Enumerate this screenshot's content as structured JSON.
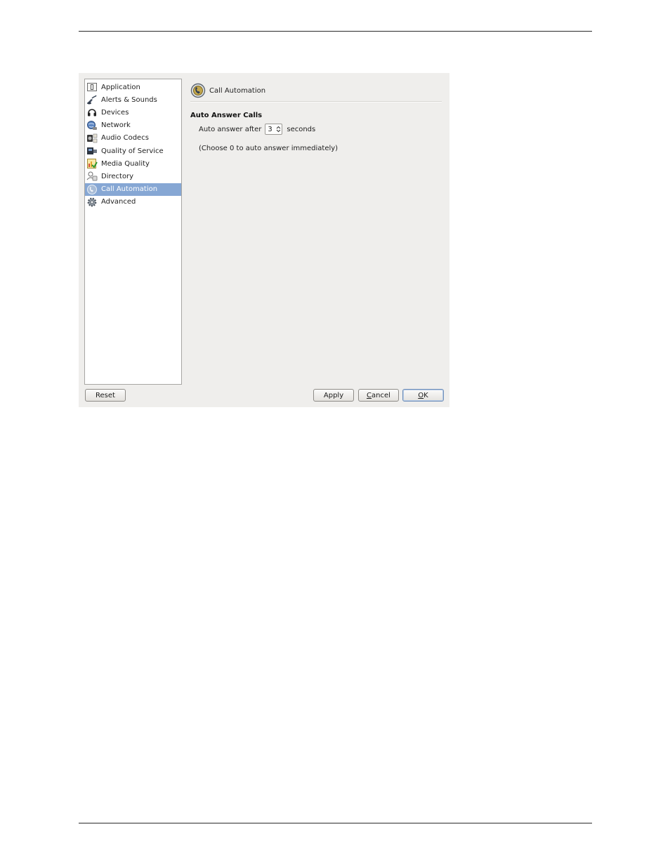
{
  "sidebar": {
    "items": [
      {
        "label": "Application",
        "icon": "application-icon"
      },
      {
        "label": "Alerts & Sounds",
        "icon": "speaker-icon"
      },
      {
        "label": "Devices",
        "icon": "headset-icon"
      },
      {
        "label": "Network",
        "icon": "network-globe-icon"
      },
      {
        "label": "Audio Codecs",
        "icon": "audio-codecs-icon"
      },
      {
        "label": "Quality of Service",
        "icon": "quality-of-service-icon"
      },
      {
        "label": "Media Quality",
        "icon": "media-quality-icon"
      },
      {
        "label": "Directory",
        "icon": "directory-icon"
      },
      {
        "label": "Call Automation",
        "icon": "call-automation-icon",
        "selected": true
      },
      {
        "label": "Advanced",
        "icon": "gear-icon"
      }
    ],
    "selected_color": "#86a7d4"
  },
  "content": {
    "title": "Call Automation",
    "section_heading": "Auto Answer Calls",
    "auto_answer_label": "Auto answer after",
    "auto_answer_value": "3",
    "auto_answer_unit": "seconds",
    "hint": "(Choose 0 to auto answer immediately)"
  },
  "buttons": {
    "reset": "Reset",
    "apply": "Apply",
    "cancel_mnemonic": "C",
    "cancel_rest": "ancel",
    "ok_mnemonic": "O",
    "ok_rest": "K"
  }
}
